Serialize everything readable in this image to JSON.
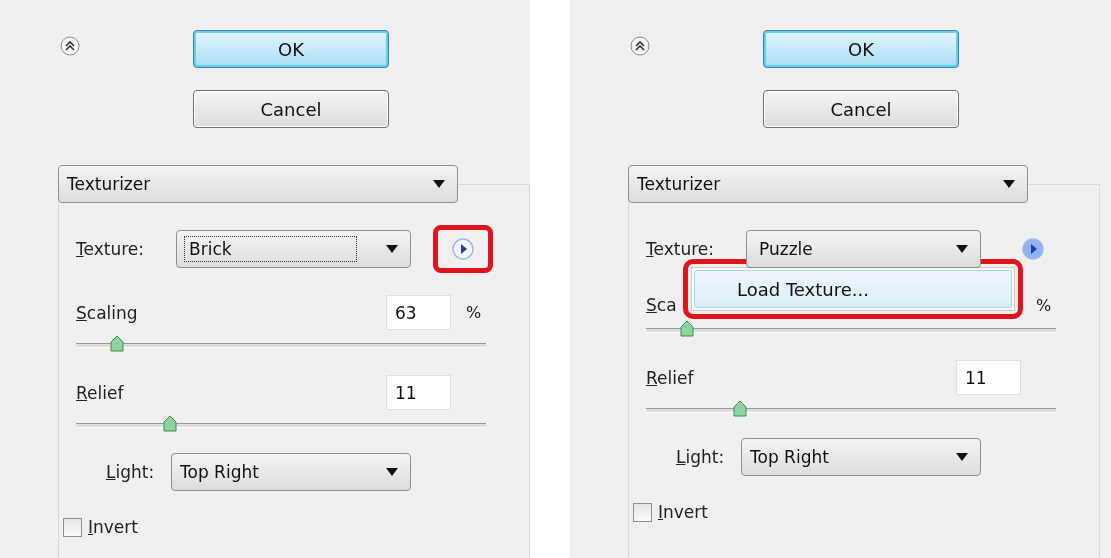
{
  "panels": [
    {
      "buttons": [
        {
          "label": "OK",
          "default": true
        },
        {
          "label": "Cancel",
          "default": false
        }
      ],
      "filter": {
        "value": "Texturizer"
      },
      "texture": {
        "label": "Texture:",
        "value": "Brick",
        "focused": true,
        "flyout": {
          "active": false,
          "highlighted": true
        }
      },
      "sliders": [
        {
          "label": "Scaling",
          "value": "63",
          "unit": "%",
          "level": 0.1
        },
        {
          "label": "Relief",
          "value": "11",
          "level": 0.23
        }
      ],
      "light": {
        "label": "Light:",
        "value": "Top Right"
      },
      "invert": {
        "label": "Invert",
        "checked": false
      }
    },
    {
      "buttons": [
        {
          "label": "OK",
          "default": true
        },
        {
          "label": "Cancel",
          "default": false
        }
      ],
      "filter": {
        "value": "Texturizer"
      },
      "texture": {
        "label": "Texture:",
        "value": "Puzzle",
        "focused": false,
        "flyout": {
          "active": true,
          "highlighted": false
        }
      },
      "menu": {
        "highlighted": true,
        "items": [
          {
            "label": "Load Texture...",
            "selected": true
          }
        ]
      },
      "sliders": [
        {
          "label": "Sca",
          "unit": "%",
          "level": 0.1
        },
        {
          "label": "Relief",
          "value": "11",
          "level": 0.23
        }
      ],
      "light": {
        "label": "Light:",
        "value": "Top Right"
      },
      "invert": {
        "label": "Invert",
        "checked": false
      }
    }
  ]
}
